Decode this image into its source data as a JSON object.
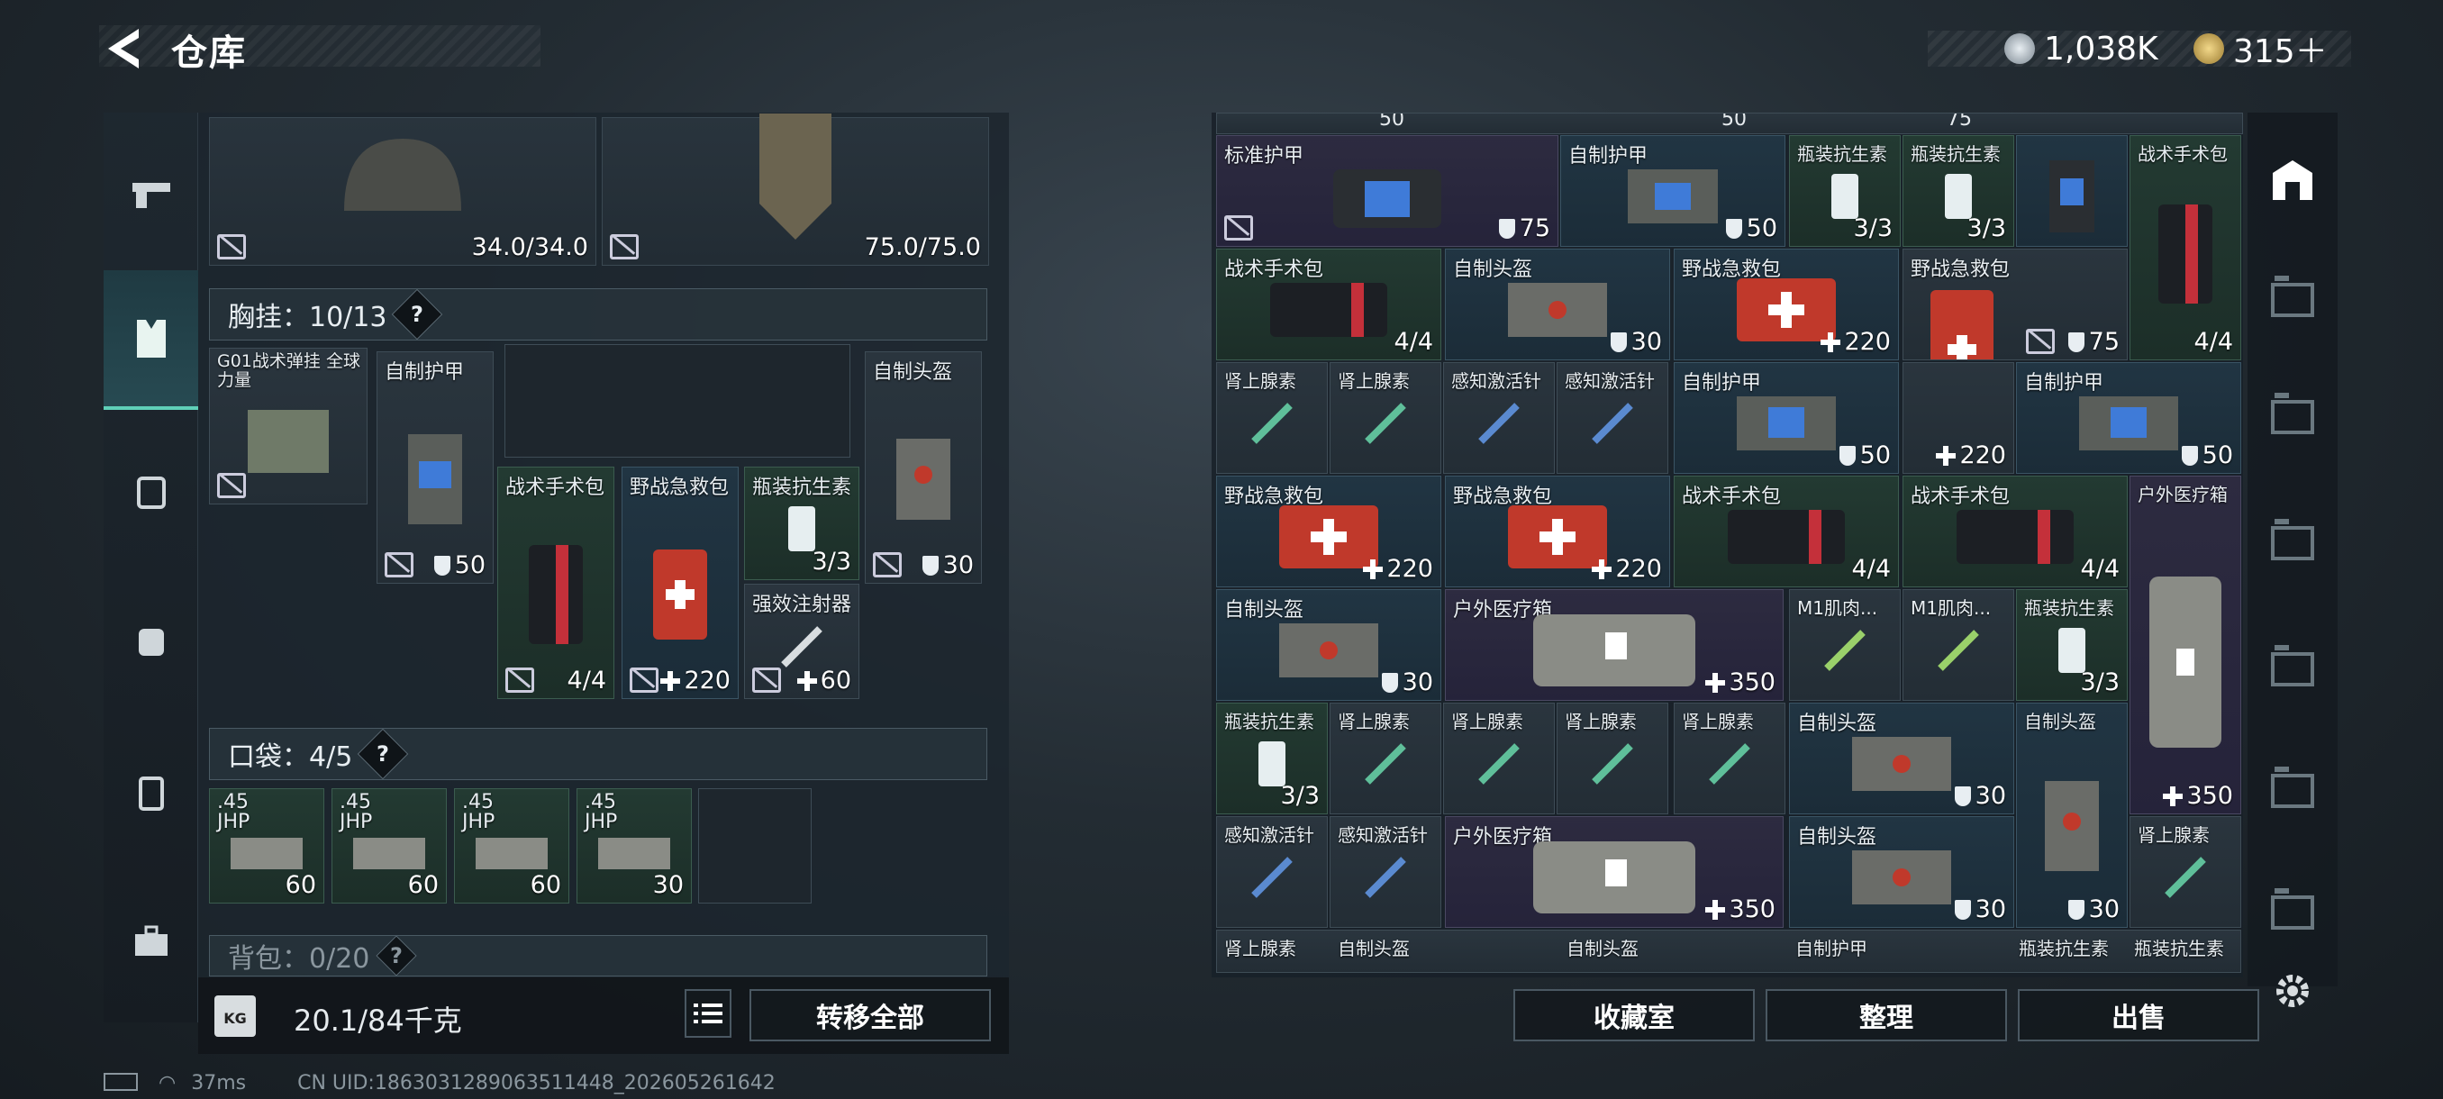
{
  "header": {
    "title": "仓库",
    "currency_silver": "1,038K",
    "currency_gold": "315＋"
  },
  "left": {
    "helmet_durability": "34.0/34.0",
    "armor_durability": "75.0/75.0",
    "rig_section": "胸挂：10/13",
    "rig_name": "G01战术弹挂 全球力量",
    "rig_items": [
      {
        "name": "自制护甲",
        "value": "50",
        "icon": "shield-icon"
      },
      {
        "name": "战术手术包",
        "value": "4/4",
        "icon": ""
      },
      {
        "name": "野战急救包",
        "value": "220",
        "icon": "plus-icon"
      },
      {
        "name": "瓶装抗生素",
        "value": "3/3",
        "icon": ""
      },
      {
        "name": "强效注射器",
        "value": "60",
        "icon": "plus-icon"
      },
      {
        "name": "自制头盔",
        "value": "30",
        "icon": "shield-icon"
      }
    ],
    "pocket_section": "口袋：4/5",
    "pockets": [
      {
        "name": ".45 JHP",
        "value": "60"
      },
      {
        "name": ".45 JHP",
        "value": "60"
      },
      {
        "name": ".45 JHP",
        "value": "60"
      },
      {
        "name": ".45 JHP",
        "value": "30"
      }
    ],
    "backpack_section": "背包：0/20",
    "weight": "20.1/84千克",
    "transfer_label": "转移全部"
  },
  "grid": {
    "row0": [
      "50",
      "50",
      "75"
    ],
    "cells": [
      {
        "name": "标准护甲",
        "value": "75",
        "icon": "shield-icon"
      },
      {
        "name": "自制护甲",
        "value": "50",
        "icon": "shield-icon"
      },
      {
        "name": "瓶装抗生素",
        "value": "3/3",
        "icon": ""
      },
      {
        "name": "瓶装抗生素",
        "value": "3/3",
        "icon": ""
      },
      {
        "name": "战术手术包",
        "value": "4/4",
        "icon": ""
      },
      {
        "name": "战术手术包",
        "value": "4/4",
        "icon": ""
      },
      {
        "name": "自制头盔",
        "value": "30",
        "icon": "shield-icon"
      },
      {
        "name": "野战急救包",
        "value": "220",
        "icon": "plus-icon"
      },
      {
        "name": "野战急救包",
        "value": "75",
        "icon": "shield-icon"
      },
      {
        "name": "肾上腺素",
        "value": "",
        "icon": ""
      },
      {
        "name": "肾上腺素",
        "value": "",
        "icon": ""
      },
      {
        "name": "感知激活针",
        "value": "",
        "icon": ""
      },
      {
        "name": "感知激活针",
        "value": "",
        "icon": ""
      },
      {
        "name": "自制护甲",
        "value": "50",
        "icon": "shield-icon"
      },
      {
        "name": "",
        "value": "220",
        "icon": "plus-icon"
      },
      {
        "name": "自制护甲",
        "value": "50",
        "icon": "shield-icon"
      },
      {
        "name": "野战急救包",
        "value": "220",
        "icon": "plus-icon"
      },
      {
        "name": "野战急救包",
        "value": "220",
        "icon": "plus-icon"
      },
      {
        "name": "战术手术包",
        "value": "4/4",
        "icon": ""
      },
      {
        "name": "战术手术包",
        "value": "4/4",
        "icon": ""
      },
      {
        "name": "户外医疗箱",
        "value": "350",
        "icon": "plus-icon"
      },
      {
        "name": "自制头盔",
        "value": "30",
        "icon": "shield-icon"
      },
      {
        "name": "户外医疗箱",
        "value": "350",
        "icon": "plus-icon"
      },
      {
        "name": "M1肌肉...",
        "value": "",
        "icon": ""
      },
      {
        "name": "M1肌肉...",
        "value": "",
        "icon": ""
      },
      {
        "name": "瓶装抗生素",
        "value": "3/3",
        "icon": ""
      },
      {
        "name": "瓶装抗生素",
        "value": "3/3",
        "icon": ""
      },
      {
        "name": "肾上腺素",
        "value": "",
        "icon": ""
      },
      {
        "name": "肾上腺素",
        "value": "",
        "icon": ""
      },
      {
        "name": "肾上腺素",
        "value": "",
        "icon": ""
      },
      {
        "name": "肾上腺素",
        "value": "",
        "icon": ""
      },
      {
        "name": "自制头盔",
        "value": "30",
        "icon": "shield-icon"
      },
      {
        "name": "自制头盔",
        "value": "30",
        "icon": "shield-icon"
      },
      {
        "name": "感知激活针",
        "value": "",
        "icon": ""
      },
      {
        "name": "感知激活针",
        "value": "",
        "icon": ""
      },
      {
        "name": "户外医疗箱",
        "value": "350",
        "icon": "plus-icon"
      },
      {
        "name": "自制头盔",
        "value": "30",
        "icon": "shield-icon"
      },
      {
        "name": "肾上腺素",
        "value": "",
        "icon": ""
      }
    ],
    "last_row": [
      "肾上腺素",
      "自制头盔",
      "自制头盔",
      "自制护甲",
      "瓶装抗生素",
      "瓶装抗生素"
    ]
  },
  "actions": {
    "collection": "收藏室",
    "organize": "整理",
    "sell": "出售"
  },
  "status": {
    "ping": "37ms",
    "uid": "CN UID:1863031289063511448_202605261642"
  }
}
